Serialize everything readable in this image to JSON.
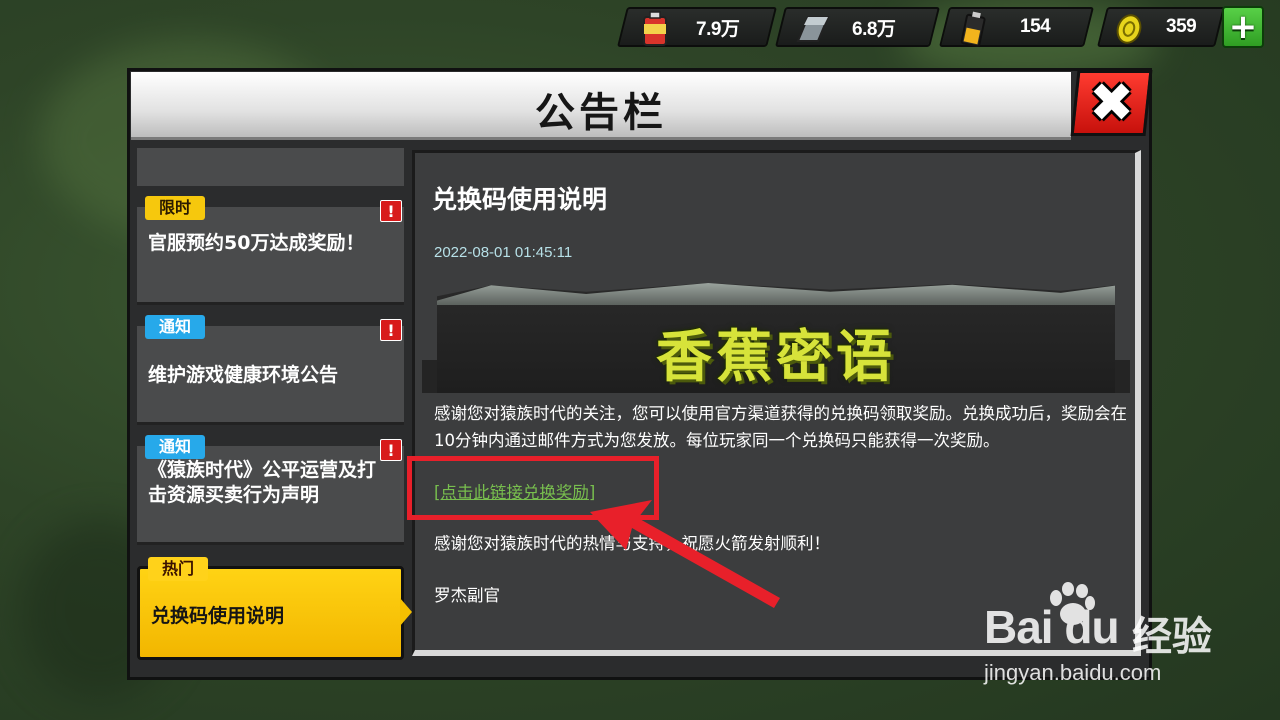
{
  "resources": [
    {
      "name": "fuel-can-icon",
      "value": "7.9万"
    },
    {
      "name": "steel-icon",
      "value": "6.8万"
    },
    {
      "name": "battery-icon",
      "value": "154"
    },
    {
      "name": "coin-icon",
      "value": "359"
    }
  ],
  "plus_label": "+",
  "title": "公告栏",
  "close_label": "✖",
  "sidebar": {
    "items": [
      {
        "tag": "限时",
        "title": "官服预约50万达成奖励！",
        "alert": "!"
      },
      {
        "tag": "通知",
        "title": "维护游戏健康环境公告",
        "alert": "!"
      },
      {
        "tag": "通知",
        "title": "《猿族时代》公平运营及打击资源买卖行为声明",
        "alert": "!"
      },
      {
        "tag": "热门",
        "title": "兑换码使用说明"
      }
    ]
  },
  "content": {
    "title": "兑换码使用说明",
    "date": "2022-08-01 01:45:11",
    "banner": "香蕉密语",
    "body": "感谢您对猿族时代的关注，您可以使用官方渠道获得的兑换码领取奖励。兑换成功后，奖励会在10分钟内通过邮件方式为您发放。每位玩家同一个兑换码只能获得一次奖励。",
    "link": "[点击此链接兑换奖励]",
    "thanks": "感谢您对猿族时代的热情与支持，祝愿火箭发射顺利！",
    "signature": "罗杰副官"
  },
  "watermark": {
    "brand": "Bai du",
    "product": "经验",
    "url": "jingyan.baidu.com"
  },
  "colors": {
    "accent": "#f5c000",
    "highlight": "#e8202a",
    "link": "#78bf4e",
    "close": "#e0201a"
  }
}
